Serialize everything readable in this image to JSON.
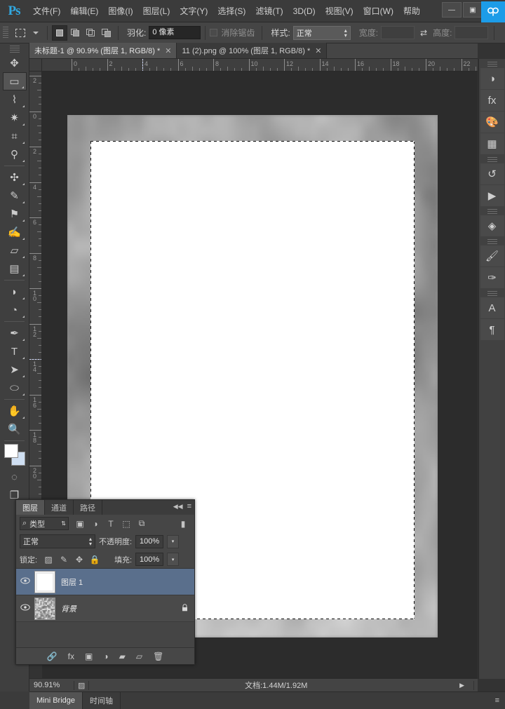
{
  "app": {
    "logo": "Ps",
    "menus": [
      {
        "label": "文件(F)"
      },
      {
        "label": "编辑(E)"
      },
      {
        "label": "图像(I)"
      },
      {
        "label": "图层(L)"
      },
      {
        "label": "文字(Y)"
      },
      {
        "label": "选择(S)"
      },
      {
        "label": "滤镜(T)"
      },
      {
        "label": "3D(D)"
      },
      {
        "label": "视图(V)"
      },
      {
        "label": "窗口(W)"
      },
      {
        "label": "帮助"
      }
    ],
    "window_controls": {
      "minimize": "—",
      "maximize": "▣",
      "close": "✕"
    },
    "accent_color": "#31a8e0",
    "badge_color": "#1c9ce8"
  },
  "options_bar": {
    "tool_name": "marquee-tool",
    "selection_modes": [
      "new-selection",
      "add-to-selection",
      "subtract-from-selection",
      "intersect-with-selection"
    ],
    "active_selection_mode": 0,
    "feather_label": "羽化:",
    "feather_value": "0 像素",
    "antialias_label": "消除锯齿",
    "antialias_checked": false,
    "style_label": "样式:",
    "style_value": "正常",
    "width_label": "宽度:",
    "width_value": "",
    "height_label": "高度:",
    "height_value": "",
    "swap_icon": "⇄"
  },
  "tabs": [
    {
      "title": "未标题-1 @ 90.9% (图层 1, RGB/8) *",
      "active": true,
      "close": "✕"
    },
    {
      "title": "11 (2).png @ 100% (图层 1, RGB/8) *",
      "active": false,
      "close": "✕"
    }
  ],
  "rulers": {
    "unit": "cm",
    "horizontal_labels": [
      "0",
      "2",
      "4",
      "6",
      "8",
      "10",
      "12",
      "14",
      "16",
      "18",
      "20",
      "22"
    ],
    "vertical_labels": [
      "2",
      "0",
      "2",
      "4",
      "6",
      "8",
      "10",
      "12",
      "14",
      "16",
      "18",
      "20"
    ]
  },
  "toolbar": {
    "tools": [
      {
        "name": "move-tool",
        "glyph": "✥",
        "active": false,
        "corner": false
      },
      {
        "name": "rectangular-marquee-tool",
        "glyph": "▭",
        "active": true,
        "corner": true
      },
      {
        "name": "lasso-tool",
        "glyph": "⌇",
        "active": false,
        "corner": true
      },
      {
        "name": "magic-wand-tool",
        "glyph": "✷",
        "active": false,
        "corner": true
      },
      {
        "name": "crop-tool",
        "glyph": "⌗",
        "active": false,
        "corner": true
      },
      {
        "name": "eyedropper-tool",
        "glyph": "⚲",
        "active": false,
        "corner": true
      },
      {
        "name": "spot-healing-brush-tool",
        "glyph": "✣",
        "active": false,
        "corner": true
      },
      {
        "name": "brush-tool",
        "glyph": "✎",
        "active": false,
        "corner": true
      },
      {
        "name": "clone-stamp-tool",
        "glyph": "⚑",
        "active": false,
        "corner": true
      },
      {
        "name": "history-brush-tool",
        "glyph": "✍",
        "active": false,
        "corner": true
      },
      {
        "name": "eraser-tool",
        "glyph": "▱",
        "active": false,
        "corner": true
      },
      {
        "name": "gradient-tool",
        "glyph": "▤",
        "active": false,
        "corner": true
      },
      {
        "name": "blur-tool",
        "glyph": "◗",
        "active": false,
        "corner": true
      },
      {
        "name": "dodge-tool",
        "glyph": "◔",
        "active": false,
        "corner": true
      },
      {
        "name": "pen-tool",
        "glyph": "✒",
        "active": false,
        "corner": true
      },
      {
        "name": "type-tool",
        "glyph": "T",
        "active": false,
        "corner": true
      },
      {
        "name": "path-selection-tool",
        "glyph": "➤",
        "active": false,
        "corner": true
      },
      {
        "name": "ellipse-shape-tool",
        "glyph": "⬭",
        "active": false,
        "corner": true
      },
      {
        "name": "hand-tool",
        "glyph": "✋",
        "active": false,
        "corner": true
      },
      {
        "name": "zoom-tool",
        "glyph": "🔍",
        "active": false,
        "corner": false
      }
    ],
    "foreground_color": "#ffffff",
    "background_color": "#cfdff2",
    "quick_mask_glyph": "◌",
    "screen_mode_glyph": "❐"
  },
  "right_dock": {
    "items": [
      {
        "name": "adjustments-icon",
        "glyph": "◑"
      },
      {
        "name": "styles-fx-icon",
        "glyph": "fx"
      },
      {
        "name": "color-palette-icon",
        "glyph": "🎨"
      },
      {
        "name": "swatches-grid-icon",
        "glyph": "▦"
      },
      {
        "name": "history-icon",
        "glyph": "↺"
      },
      {
        "name": "actions-play-icon",
        "glyph": "▶"
      },
      {
        "name": "3d-panel-icon",
        "glyph": "◈"
      },
      {
        "name": "brush-panel-icon",
        "glyph": "🖌"
      },
      {
        "name": "brush-presets-icon",
        "glyph": "✑"
      },
      {
        "name": "character-panel-icon",
        "glyph": "A"
      },
      {
        "name": "paragraph-panel-icon",
        "glyph": "¶"
      }
    ]
  },
  "layers_panel": {
    "tabs": [
      {
        "label": "图层",
        "active": true
      },
      {
        "label": "通道",
        "active": false
      },
      {
        "label": "路径",
        "active": false
      }
    ],
    "collapse_icon": "◀◀",
    "menu_icon": "≡",
    "filter": {
      "search_icon": "⌕",
      "value": "类型",
      "chevron": "⇅"
    },
    "filter_icons": [
      {
        "name": "filter-pixel-icon",
        "glyph": "▣"
      },
      {
        "name": "filter-adjustment-icon",
        "glyph": "◑"
      },
      {
        "name": "filter-type-icon",
        "glyph": "T"
      },
      {
        "name": "filter-shape-icon",
        "glyph": "⬚"
      },
      {
        "name": "filter-smart-object-icon",
        "glyph": "⧉"
      }
    ],
    "filter_toggle": "▮",
    "blend_mode": "正常",
    "opacity_label": "不透明度:",
    "opacity_value": "100%",
    "lock_label": "锁定:",
    "lock_icons": [
      {
        "name": "lock-transparent-pixels-icon",
        "glyph": "▨"
      },
      {
        "name": "lock-image-pixels-icon",
        "glyph": "✎"
      },
      {
        "name": "lock-position-icon",
        "glyph": "✥"
      },
      {
        "name": "lock-all-icon",
        "glyph": "🔒"
      }
    ],
    "fill_label": "填充:",
    "fill_value": "100%",
    "layers": [
      {
        "name": "图层 1",
        "visible": true,
        "selected": true,
        "locked": false,
        "type": "white"
      },
      {
        "name": "背景",
        "visible": true,
        "selected": false,
        "locked": true,
        "type": "texture"
      }
    ],
    "eye_glyph": "👁",
    "lock_glyph": "🔒",
    "footer_icons": [
      {
        "name": "link-layers-icon",
        "glyph": "🔗"
      },
      {
        "name": "layer-style-fx-icon",
        "glyph": "fx"
      },
      {
        "name": "add-layer-mask-icon",
        "glyph": "▣"
      },
      {
        "name": "new-fill-adjustment-icon",
        "glyph": "◑"
      },
      {
        "name": "new-group-icon",
        "glyph": "▰"
      },
      {
        "name": "new-layer-icon",
        "glyph": "▱"
      },
      {
        "name": "delete-layer-icon",
        "glyph": "🗑"
      }
    ]
  },
  "status_bar": {
    "zoom": "90.91%",
    "doc_icon": "▨",
    "doc_info": "文档:1.44M/1.92M",
    "arrow": "▶"
  },
  "bottom_tabs": [
    {
      "label": "Mini Bridge",
      "active": true
    },
    {
      "label": "时间轴",
      "active": false
    }
  ],
  "bottom_right_icon": "≡"
}
